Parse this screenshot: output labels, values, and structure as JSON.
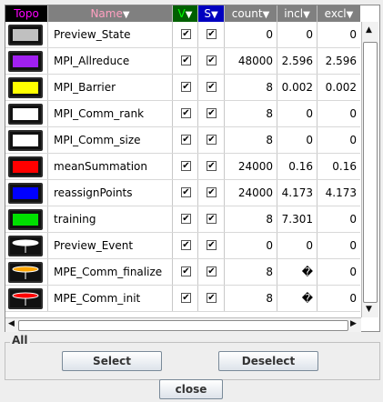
{
  "headers": {
    "topo": "Topo",
    "name": "Name",
    "v": "V",
    "s": "S",
    "count": "count",
    "incl": "incl",
    "excl": "excl",
    "sort_arrow": "▼"
  },
  "rows": [
    {
      "name": "Preview_State",
      "count": "0",
      "incl": "0",
      "excl": "0",
      "v": true,
      "s": true,
      "swatch": {
        "color": "#c0c0c0",
        "kind": "box"
      }
    },
    {
      "name": "MPI_Allreduce",
      "count": "48000",
      "incl": "2.596",
      "excl": "2.596",
      "v": true,
      "s": true,
      "swatch": {
        "color": "#a020f0",
        "kind": "box"
      }
    },
    {
      "name": "MPI_Barrier",
      "count": "8",
      "incl": "0.002",
      "excl": "0.002",
      "v": true,
      "s": true,
      "swatch": {
        "color": "#ffff00",
        "kind": "box"
      }
    },
    {
      "name": "MPI_Comm_rank",
      "count": "8",
      "incl": "0",
      "excl": "0",
      "v": true,
      "s": true,
      "swatch": {
        "color": "#ffffff",
        "kind": "box"
      }
    },
    {
      "name": "MPI_Comm_size",
      "count": "8",
      "incl": "0",
      "excl": "0",
      "v": true,
      "s": true,
      "swatch": {
        "color": "#ffffff",
        "kind": "box"
      }
    },
    {
      "name": "meanSummation",
      "count": "24000",
      "incl": "0.16",
      "excl": "0.16",
      "v": true,
      "s": true,
      "swatch": {
        "color": "#ff0000",
        "kind": "box"
      }
    },
    {
      "name": "reassignPoints",
      "count": "24000",
      "incl": "4.173",
      "excl": "4.173",
      "v": true,
      "s": true,
      "swatch": {
        "color": "#0000ff",
        "kind": "box"
      }
    },
    {
      "name": "training",
      "count": "8",
      "incl": "7.301",
      "excl": "0",
      "v": true,
      "s": true,
      "swatch": {
        "color": "#00e000",
        "kind": "box"
      }
    },
    {
      "name": "Preview_Event",
      "count": "0",
      "incl": "0",
      "excl": "0",
      "v": true,
      "s": true,
      "swatch": {
        "color": "#ffffff",
        "kind": "event"
      }
    },
    {
      "name": "MPE_Comm_finalize",
      "count": "8",
      "incl": "�",
      "excl": "0",
      "v": true,
      "s": true,
      "swatch": {
        "color": "#ffa500",
        "kind": "event"
      }
    },
    {
      "name": "MPE_Comm_init",
      "count": "8",
      "incl": "�",
      "excl": "0",
      "v": true,
      "s": true,
      "swatch": {
        "color": "#ff0000",
        "kind": "event"
      }
    }
  ],
  "check_glyph": "✔",
  "colors": {
    "topo_header_bg": "#000000",
    "topo_header_text": "#ff00ff",
    "name_header_text": "#ffa0c0",
    "v_header_bg": "#006000",
    "v_header_text": "#00ff00",
    "s_header_bg": "#0000c0",
    "s_header_text": "#ffffff"
  },
  "group_label": "All",
  "buttons": {
    "select": "Select",
    "deselect": "Deselect",
    "close": "close"
  },
  "scroll": {
    "up": "▲",
    "down": "▼",
    "left": "◀",
    "right": "▶"
  }
}
